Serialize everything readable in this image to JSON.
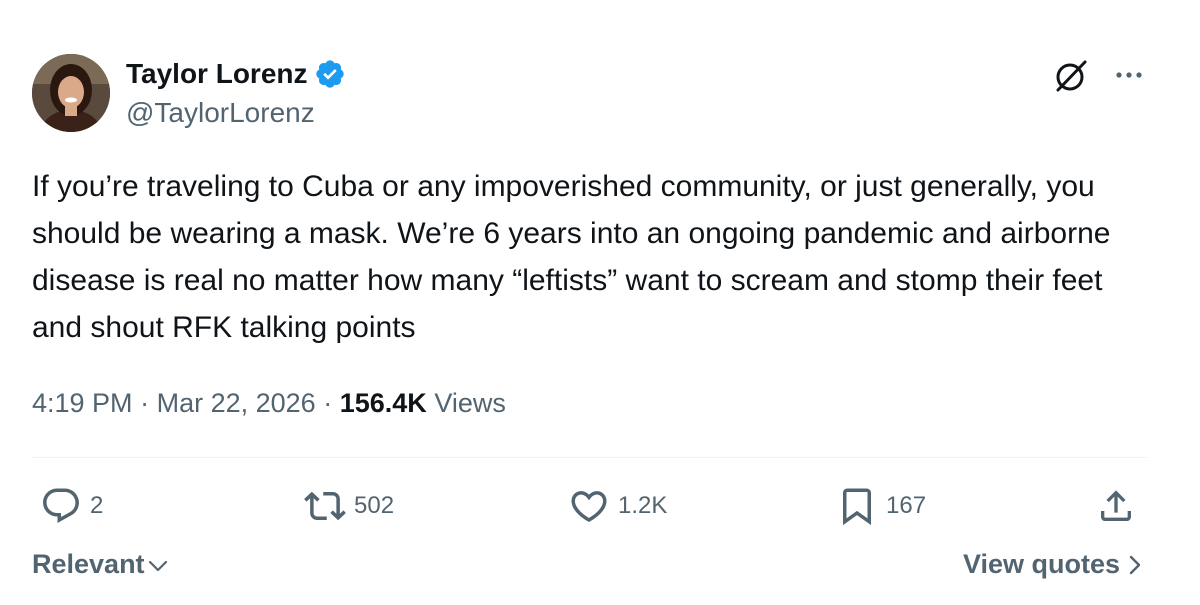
{
  "author": {
    "display_name": "Taylor Lorenz",
    "handle": "@TaylorLorenz",
    "verified": true
  },
  "tweet": {
    "text": "If you’re traveling to Cuba or any impoverished community, or just generally, you should be wearing a mask. We’re 6 years into an ongoing pandemic and airborne disease is real no matter how many “leftists” want to scream and stomp their feet and shout RFK talking points",
    "time": "4:19 PM",
    "separator": "·",
    "date": "Mar 22, 2026",
    "views_count": "156.4K",
    "views_label": "Views"
  },
  "actions": {
    "replies": "2",
    "reposts": "502",
    "likes": "1.2K",
    "bookmarks": "167"
  },
  "footer": {
    "sort_label": "Relevant",
    "view_quotes_label": "View quotes"
  },
  "icons": {
    "verified": "verified-badge-icon",
    "grok": "grok-icon",
    "more": "more-icon",
    "reply": "reply-icon",
    "repost": "repost-icon",
    "like": "heart-icon",
    "bookmark": "bookmark-icon",
    "share": "share-icon"
  },
  "colors": {
    "verified_blue": "#1d9bf0",
    "secondary_text": "#536471",
    "primary_text": "#0f1419",
    "divider": "#eff3f4"
  }
}
